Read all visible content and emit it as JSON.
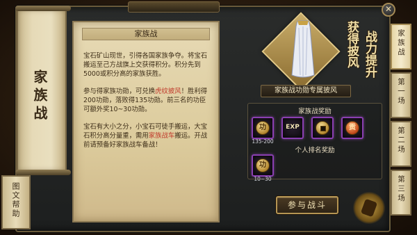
{
  "left_panel": {
    "title": "家族战",
    "help_label": "图文帮助"
  },
  "parchment": {
    "header": "家族战",
    "paragraphs": [
      {
        "parts": [
          {
            "text": "宝石矿山现世，引得各国家族争夺。将宝石搬运至己方战旗上交获得积分。积分先到5000或积分高的家族获胜。",
            "color": ""
          }
        ]
      },
      {
        "parts": [
          {
            "text": "参与得家族功勋，可兑换",
            "color": ""
          },
          {
            "text": "虎纹披风",
            "color": "#c0392b"
          },
          {
            "text": "！胜利得200功勋，落败得135功勋。前三名的功臣可额外奖10~30功勋。",
            "color": ""
          }
        ]
      },
      {
        "parts": [
          {
            "text": "宝石有大小之分，小宝石可徒手搬运，大宝石积分高分量重，需用",
            "color": ""
          },
          {
            "text": "家族战车",
            "color": "#c0392b"
          },
          {
            "text": "搬运。开战前请预备好家族战车备战！",
            "color": ""
          }
        ]
      }
    ]
  },
  "promo": {
    "col1": "获得披风",
    "col2": "战力提升"
  },
  "cape_caption": "家族战功勋专属披风",
  "rewards": {
    "family_label": "家族战奖励",
    "family_items": [
      {
        "icon": "merit-coin-icon",
        "glyph": "功",
        "count": "135-200"
      },
      {
        "icon": "exp-icon",
        "glyph": "EXP",
        "count": ""
      },
      {
        "icon": "gold-coin-icon",
        "glyph": "",
        "count": ""
      },
      {
        "icon": "contribution-coin-icon",
        "glyph": "贡",
        "count": ""
      }
    ],
    "rank_label": "个人排名奖励",
    "rank_items": [
      {
        "icon": "merit-coin-icon",
        "glyph": "功",
        "count": "10~30"
      }
    ]
  },
  "join_button": "参与战斗",
  "tabs": [
    {
      "label": "家族战",
      "active": true
    },
    {
      "label": "第一场",
      "active": false
    },
    {
      "label": "第二场",
      "active": false
    },
    {
      "label": "第三场",
      "active": false
    }
  ],
  "close_glyph": "✕",
  "colors": {
    "highlight": "#c0392b",
    "slot_border": "#8a3fb1",
    "gold_text": "#f1dfa6"
  }
}
